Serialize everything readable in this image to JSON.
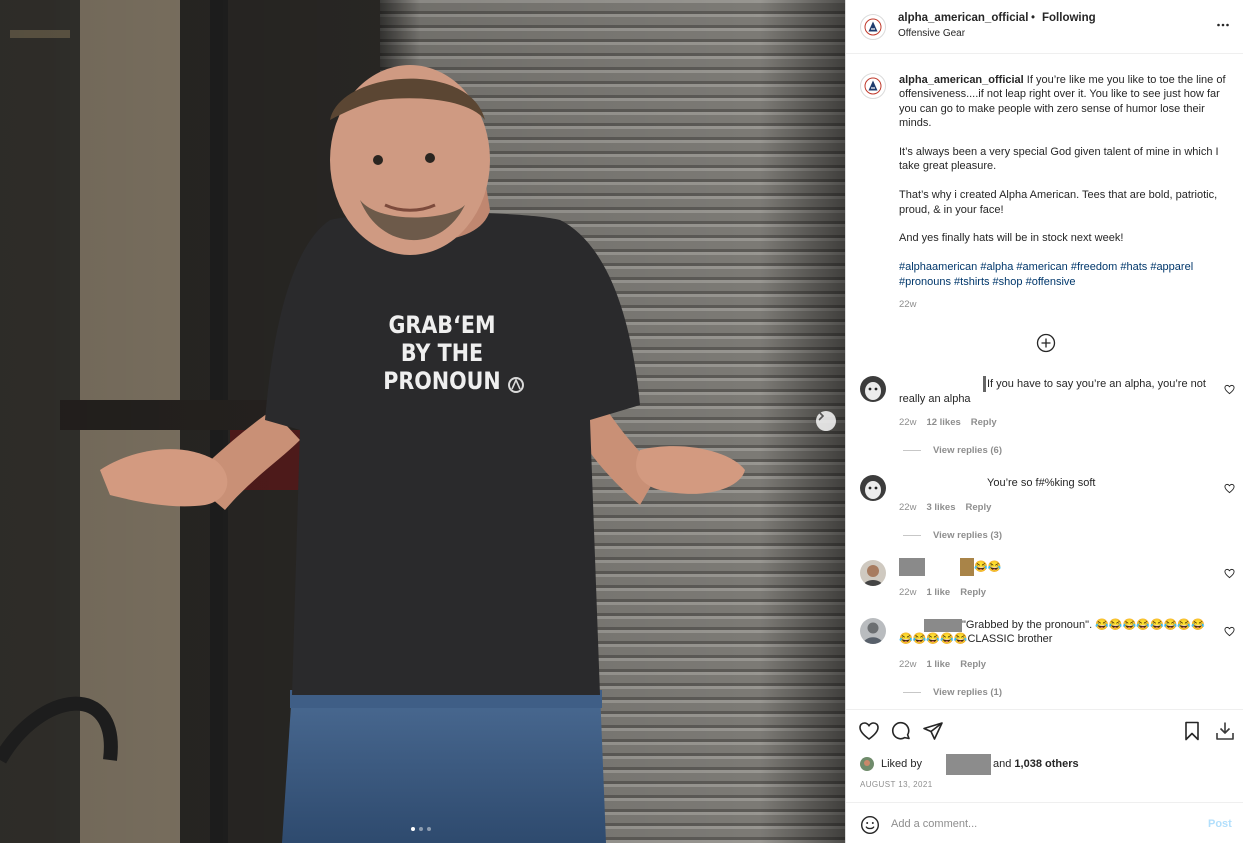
{
  "post": {
    "username": "alpha_american_official",
    "follow_label": "Following",
    "separator": "•",
    "subtitle": "Offensive Gear",
    "more_icon": "more-horizontal-icon"
  },
  "image": {
    "shirt_text": [
      "GRAB‘EM",
      "BY THE",
      "PRONOUN"
    ],
    "carousel_position": 1,
    "carousel_count": 3
  },
  "caption": {
    "username": "alpha_american_official",
    "paragraphs": [
      "If you’re like me you like to toe the line of offensiveness....if not leap right over it. You like to see just how far you can go to make people with zero sense of humor lose their minds.",
      "It’s always been a very special God given talent of mine in which I take great pleasure.",
      "That’s why i created Alpha American. Tees that are bold, patriotic, proud, & in your face!",
      "And yes finally hats will be in stock next week!"
    ],
    "hashtags": "#alphaamerican #alpha #american #freedom #hats #apparel #pronouns #tshirts #shop #offensive",
    "time": "22w"
  },
  "comments": [
    {
      "text": "If you have to say you’re an alpha, you’re not really an alpha",
      "time": "22w",
      "likes": "12 likes",
      "reply": "Reply",
      "view_replies": "View replies (6)"
    },
    {
      "text": "You’re so f#%king soft",
      "time": "22w",
      "likes": "3 likes",
      "reply": "Reply",
      "view_replies": "View replies (3)"
    },
    {
      "text": "😂😂",
      "time": "22w",
      "likes": "1 like",
      "reply": "Reply"
    },
    {
      "text": "\"Grabbed by the pronoun\". 😂😂😂😂😂😂😂😂😂😂😂😂😂CLASSIC brother",
      "time": "22w",
      "likes": "1 like",
      "reply": "Reply",
      "view_replies": "View replies (1)"
    }
  ],
  "footer": {
    "liked_by_prefix": "Liked by",
    "liked_by_suffix": "and",
    "others": "1,038 others",
    "date": "AUGUST 13, 2021",
    "comment_placeholder": "Add a comment...",
    "post_label": "Post"
  },
  "colors": {
    "hashtag": "#00376b",
    "muted": "#8e8e8e",
    "post_button": "#b2dffc",
    "text": "#262626"
  }
}
